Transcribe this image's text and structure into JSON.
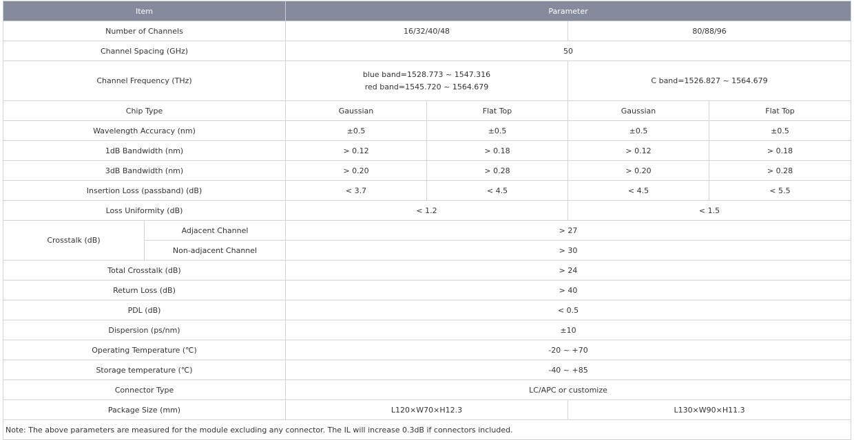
{
  "header": {
    "item": "Item",
    "parameter": "Parameter"
  },
  "rows": {
    "channels": {
      "label": "Number of Channels",
      "a": "16/32/40/48",
      "b": "80/88/96"
    },
    "spacing": {
      "label": "Channel Spacing (GHz)",
      "value": "50"
    },
    "frequency": {
      "label": "Channel Frequency (THz)",
      "a_line1": "blue band=1528.773 ~ 1547.316",
      "a_line2": "red band=1545.720 ~ 1564.679",
      "b": "C band=1526.827 ~ 1564.679"
    },
    "chip": {
      "label": "Chip Type",
      "c1": "Gaussian",
      "c2": "Flat Top",
      "c3": "Gaussian",
      "c4": "Flat Top"
    },
    "accuracy": {
      "label": "Wavelength Accuracy (nm)",
      "c1": "±0.5",
      "c2": "±0.5",
      "c3": "±0.5",
      "c4": "±0.5"
    },
    "bw1": {
      "label": "1dB Bandwidth (nm)",
      "c1": "> 0.12",
      "c2": "> 0.18",
      "c3": "> 0.12",
      "c4": "> 0.18"
    },
    "bw3": {
      "label": "3dB Bandwidth (nm)",
      "c1": "> 0.20",
      "c2": "> 0.28",
      "c3": "> 0.20",
      "c4": "> 0.28"
    },
    "il": {
      "label": "Insertion Loss (passband) (dB)",
      "c1": "< 3.7",
      "c2": "< 4.5",
      "c3": "< 4.5",
      "c4": "< 5.5"
    },
    "uniformity": {
      "label": "Loss Uniformity (dB)",
      "a": "< 1.2",
      "b": "< 1.5"
    },
    "crosstalk": {
      "label": "Crosstalk (dB)",
      "adj_label": "Adjacent Channel",
      "adj_value": "> 27",
      "nonadj_label": "Non-adjacent Channel",
      "nonadj_value": "> 30"
    },
    "total_crosstalk": {
      "label": "Total Crosstalk (dB)",
      "value": "> 24"
    },
    "return_loss": {
      "label": "Return Loss (dB)",
      "value": "> 40"
    },
    "pdl": {
      "label": "PDL (dB)",
      "value": "< 0.5"
    },
    "dispersion": {
      "label": "Dispersion (ps/nm)",
      "value": "±10"
    },
    "op_temp": {
      "label": "Operating Temperature (℃)",
      "value": "-20 ~ +70"
    },
    "st_temp": {
      "label": "Storage temperature (℃)",
      "value": "-40 ~ +85"
    },
    "connector": {
      "label": "Connector Type",
      "value": "LC/APC or customize"
    },
    "package": {
      "label": "Package Size (mm)",
      "a": "L120×W70×H12.3",
      "b": "L130×W90×H11.3"
    }
  },
  "note": "Note: The above parameters are measured for the module excluding any connector. The IL will increase 0.3dB if connectors included."
}
